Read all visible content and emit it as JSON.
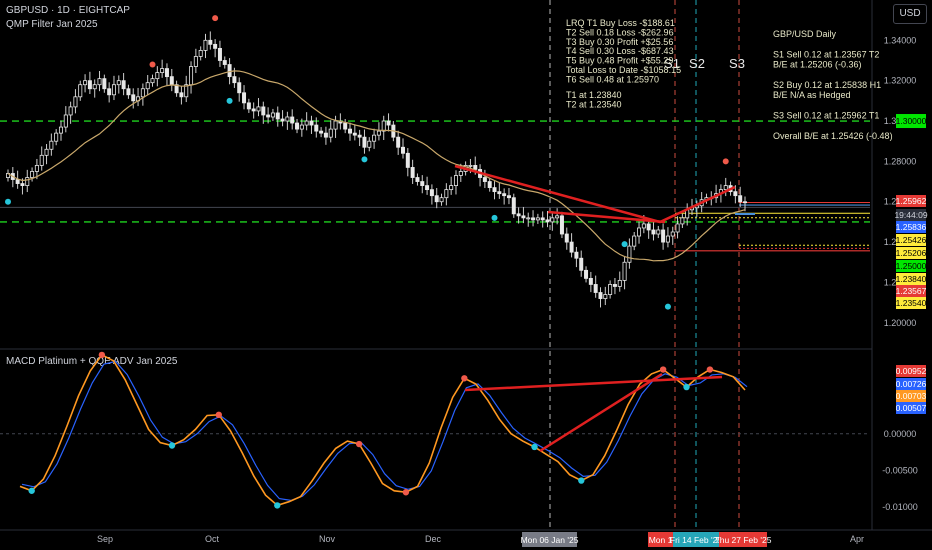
{
  "header": {
    "symbol": "GBPUSD · 1D · EIGHTCAP",
    "indicator": "QMP Filter Jan 2025",
    "currency_button": "USD"
  },
  "notes": {
    "trades": [
      "LRQ T1 Buy Loss -$188.61",
      "T2 Sell 0.18 Loss -$262.96",
      "T3 Buy 0.30 Profit +$25.56",
      "T4 Sell 0.30 Loss -$687.43",
      "T5 Buy 0.48 Profit +$55.29",
      "Total Loss to Date -$1058.15",
      "T6 Sell 0.48 at 1.25970"
    ],
    "targets": [
      "T1 at 1.23840",
      "T2 at 1.23540"
    ],
    "plan": [
      "GBP/USD Daily",
      "",
      "S1 Sell 0.12 at 1.23567 T2",
      "B/E at 1.25206 (-0.36)",
      "",
      "S2 Buy 0.12 at 1.25838 H1",
      "B/E N/A as Hedged",
      "",
      "S3 Sell 0.12 at 1.25962 T1",
      "",
      "Overall B/E at 1.25426 (-0.48)"
    ],
    "s_labels": [
      "S1",
      "S2",
      "S3"
    ]
  },
  "colors": {
    "up": "#e8e8e8",
    "down": "#e8e8e8",
    "ma": "#c9a86b",
    "green": "#1fd21f",
    "red_line": "#e02020",
    "blue_line": "#4a90d9",
    "macd": "#ff9821",
    "signal": "#2962ff",
    "dot_red": "#f05a4a",
    "dot_cyan": "#26c6da"
  },
  "chart_data": [
    {
      "type": "candlestick",
      "title": "GBPUSD · 1D · EIGHTCAP",
      "ylim": [
        1.188,
        1.358
      ],
      "y_ticks": [
        "1.34000",
        "1.32000",
        "1.30000",
        "1.28000",
        "1.26000",
        "1.24000",
        "1.22000",
        "1.20000"
      ],
      "x_ticks": [
        "Sep",
        "Oct",
        "Nov",
        "Dec",
        "Apr"
      ],
      "x_highlight_labels": [
        "Mon 06 Jan '25",
        "Mon 1",
        "Fri 14 Feb '25",
        "Thu 27 Feb '25"
      ],
      "grid": false,
      "horizontal_levels": [
        {
          "label": "1.30000",
          "value": 1.3,
          "color": "#1fd21f",
          "style": "dashed"
        },
        {
          "label": "1.25000",
          "value": 1.25,
          "color": "#1fd21f",
          "style": "dashed"
        }
      ],
      "price_labels": [
        {
          "text": "1.25962",
          "value": 1.25962,
          "bg": "#e53935",
          "fg": "#ffffff"
        },
        {
          "text": "19:44:09",
          "value": 1.2572,
          "bg": "#2a2e39",
          "fg": "#d1d4dc"
        },
        {
          "text": "1.25836",
          "value": 1.25836,
          "bg": "#2962ff",
          "fg": "#ffffff"
        },
        {
          "text": "1.25426",
          "value": 1.25426,
          "bg": "#ffeb3b",
          "fg": "#000000"
        },
        {
          "text": "1.25206",
          "value": 1.25206,
          "bg": "#ffeb3b",
          "fg": "#000000"
        },
        {
          "text": "1.25000",
          "value": 1.25,
          "bg": "#00e600",
          "fg": "#000000"
        },
        {
          "text": "1.23840",
          "value": 1.2384,
          "bg": "#ffeb3b",
          "fg": "#000000"
        },
        {
          "text": "1.23567",
          "value": 1.23567,
          "bg": "#e53935",
          "fg": "#ffffff"
        },
        {
          "text": "1.23540",
          "value": 1.2354,
          "bg": "#ffeb3b",
          "fg": "#000000"
        }
      ],
      "closes": [
        1.274,
        1.271,
        1.269,
        1.268,
        1.272,
        1.275,
        1.278,
        1.283,
        1.286,
        1.29,
        1.294,
        1.297,
        1.303,
        1.307,
        1.312,
        1.318,
        1.32,
        1.316,
        1.318,
        1.321,
        1.316,
        1.313,
        1.318,
        1.32,
        1.316,
        1.313,
        1.31,
        1.312,
        1.316,
        1.319,
        1.321,
        1.324,
        1.326,
        1.322,
        1.318,
        1.314,
        1.312,
        1.318,
        1.327,
        1.332,
        1.335,
        1.34,
        1.338,
        1.336,
        1.33,
        1.328,
        1.322,
        1.319,
        1.314,
        1.309,
        1.306,
        1.305,
        1.307,
        1.303,
        1.302,
        1.304,
        1.301,
        1.3,
        1.302,
        1.299,
        1.296,
        1.298,
        1.3,
        1.298,
        1.295,
        1.294,
        1.292,
        1.296,
        1.3,
        1.299,
        1.296,
        1.294,
        1.293,
        1.292,
        1.287,
        1.29,
        1.293,
        1.295,
        1.3,
        1.298,
        1.292,
        1.287,
        1.284,
        1.277,
        1.272,
        1.27,
        1.268,
        1.266,
        1.263,
        1.26,
        1.262,
        1.266,
        1.268,
        1.273,
        1.275,
        1.278,
        1.278,
        1.276,
        1.272,
        1.27,
        1.267,
        1.265,
        1.264,
        1.263,
        1.262,
        1.254,
        1.253,
        1.252,
        1.252,
        1.251,
        1.252,
        1.251,
        1.25,
        1.252,
        1.253,
        1.244,
        1.24,
        1.235,
        1.232,
        1.226,
        1.222,
        1.219,
        1.215,
        1.212,
        1.214,
        1.219,
        1.218,
        1.221,
        1.23,
        1.238,
        1.243,
        1.247,
        1.249,
        1.246,
        1.244,
        1.246,
        1.24,
        1.243,
        1.245,
        1.249,
        1.252,
        1.256,
        1.257,
        1.258,
        1.261,
        1.262,
        1.262,
        1.264,
        1.266,
        1.268,
        1.265,
        1.263,
        1.26,
        1.2597
      ],
      "ma_period": 20,
      "markers": [
        {
          "index": 0,
          "kind": "cyan",
          "value": 1.26
        },
        {
          "index": 30,
          "kind": "red",
          "value": 1.328
        },
        {
          "index": 43,
          "kind": "red",
          "value": 1.351
        },
        {
          "index": 46,
          "kind": "cyan",
          "value": 1.31
        },
        {
          "index": 74,
          "kind": "cyan",
          "value": 1.281
        },
        {
          "index": 101,
          "kind": "cyan",
          "value": 1.252
        },
        {
          "index": 128,
          "kind": "cyan",
          "value": 1.239
        },
        {
          "index": 137,
          "kind": "cyan",
          "value": 1.208
        },
        {
          "index": 149,
          "kind": "red",
          "value": 1.28
        }
      ]
    },
    {
      "type": "line",
      "title": "MACD Platinum + QQE ADV Jan 2025",
      "ylim": [
        -0.0118,
        0.0112
      ],
      "y_ticks": [
        "0.00000",
        "-0.00500",
        "-0.01000"
      ],
      "value_labels": [
        {
          "text": "0.00952",
          "value": 0.00952,
          "bg": "#e53935"
        },
        {
          "text": "0.00726",
          "value": 0.00726,
          "bg": "#2962ff"
        },
        {
          "text": "0.00703",
          "value": 0.00703,
          "bg": "#ff9821"
        },
        {
          "text": "0.00507",
          "value": 0.00507,
          "bg": "#2962ff"
        }
      ],
      "series": [
        {
          "values": [
            -0.0072,
            -0.0078,
            -0.0062,
            -0.003,
            0.001,
            0.0052,
            0.0086,
            0.0108,
            0.01,
            0.0074,
            0.004,
            0.0006,
            -0.0012,
            -0.0016,
            -0.0008,
            0.0006,
            0.0025,
            0.0026,
            0.0004,
            -0.0026,
            -0.0058,
            -0.0084,
            -0.0098,
            -0.0093,
            -0.0086,
            -0.0064,
            -0.004,
            -0.002,
            -0.001,
            -0.0014,
            -0.004,
            -0.0068,
            -0.0078,
            -0.008,
            -0.0072,
            -0.004,
            0.0008,
            0.005,
            0.0076,
            0.0068,
            0.0046,
            0.002,
            0.0,
            -0.001,
            -0.0018,
            -0.0028,
            -0.0038,
            -0.0056,
            -0.0064,
            -0.0056,
            -0.003,
            0.0004,
            0.004,
            0.0068,
            0.0082,
            0.0088,
            0.0076,
            0.0064,
            0.0078,
            0.0088,
            0.0084,
            0.0078,
            0.006
          ]
        }
      ],
      "markers": [
        {
          "index": 1,
          "kind": "cyan"
        },
        {
          "index": 7,
          "kind": "red"
        },
        {
          "index": 13,
          "kind": "cyan"
        },
        {
          "index": 17,
          "kind": "red"
        },
        {
          "index": 22,
          "kind": "cyan"
        },
        {
          "index": 29,
          "kind": "red"
        },
        {
          "index": 33,
          "kind": "red"
        },
        {
          "index": 38,
          "kind": "red"
        },
        {
          "index": 44,
          "kind": "cyan"
        },
        {
          "index": 48,
          "kind": "cyan"
        },
        {
          "index": 55,
          "kind": "red"
        },
        {
          "index": 57,
          "kind": "cyan"
        },
        {
          "index": 59,
          "kind": "red"
        }
      ]
    }
  ]
}
